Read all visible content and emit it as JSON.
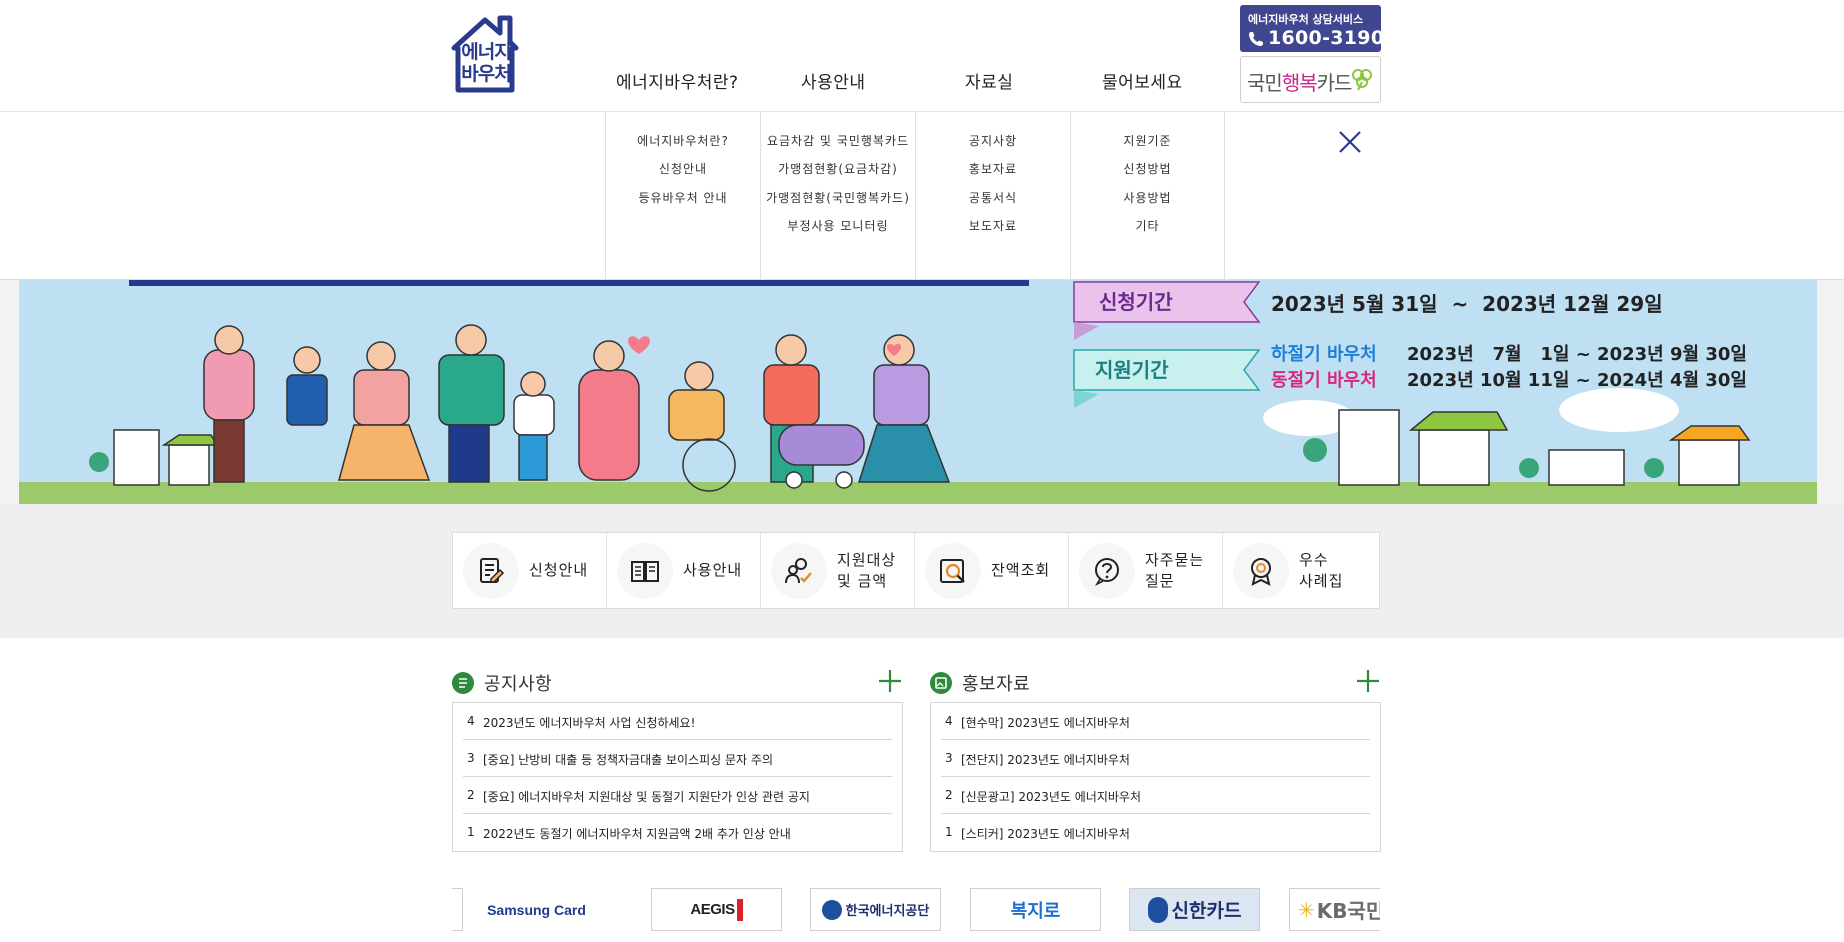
{
  "header": {
    "logo_text_line1": "에너지",
    "logo_text_line2": "바우처",
    "nav": [
      "에너지바우처란?",
      "사용안내",
      "자료실",
      "물어보세요"
    ],
    "hotline": {
      "label": "에너지바우처 상담서비스",
      "phone": "1600-3190"
    },
    "happycard": {
      "prefix": "국민",
      "accent": "행복",
      "suffix": "카드"
    }
  },
  "megamenu": {
    "columns": [
      [
        "에너지바우처란?",
        "신청안내",
        "등유바우처 안내"
      ],
      [
        "요금차감 및 국민행복카드",
        "가맹점현황(요금차감)",
        "가맹점현황(국민행복카드)",
        "부정사용 모니터링"
      ],
      [
        "공지사항",
        "홍보자료",
        "공통서식",
        "보도자료"
      ],
      [
        "지원기준",
        "신청방법",
        "사용방법",
        "기타"
      ]
    ]
  },
  "banner": {
    "apply_label": "신청기간",
    "apply_period": "2023년 5월 31일  ~  2023년 12월 29일",
    "support_label": "지원기간",
    "summer_label": "하절기 바우처",
    "summer_period": "2023년   7월   1일 ~ 2023년 9월 30일",
    "winter_label": "동절기 바우처",
    "winter_period": "2023년 10월 11일 ~ 2024년 4월 30일"
  },
  "quick_menu": [
    {
      "label": "신청안내",
      "icon": "document-pen-icon"
    },
    {
      "label": "사용안내",
      "icon": "open-book-icon"
    },
    {
      "label": "지원대상\n및 금액",
      "icon": "people-check-icon"
    },
    {
      "label": "잔액조회",
      "icon": "magnifier-icon"
    },
    {
      "label": "자주묻는\n질문",
      "icon": "question-icon"
    },
    {
      "label": "우수\n사례집",
      "icon": "award-icon"
    }
  ],
  "notice": {
    "title": "공지사항",
    "rows": [
      {
        "num": "4",
        "text": "2023년도 에너지바우처 사업 신청하세요!"
      },
      {
        "num": "3",
        "text": "[중요] 난방비 대출 등 정책자금대출 보이스피싱 문자 주의"
      },
      {
        "num": "2",
        "text": "[중요] 에너지바우처 지원대상 및 동절기 지원단가 인상 관련 공지"
      },
      {
        "num": "1",
        "text": "2022년도 동절기 에너지바우처 지원금액 2배 추가 인상 안내"
      }
    ]
  },
  "promo": {
    "title": "홍보자료",
    "rows": [
      {
        "num": "4",
        "text": "[현수막] 2023년도 에너지바우처"
      },
      {
        "num": "3",
        "text": "[전단지] 2023년도 에너지바우처"
      },
      {
        "num": "2",
        "text": "[신문광고] 2023년도 에너지바우처"
      },
      {
        "num": "1",
        "text": "[스티커] 2023년도 에너지바우처"
      }
    ]
  },
  "partners": [
    "Samsung Card",
    "AEGIS",
    "한국에너지공단",
    "복지로",
    "신한카드",
    "KB국민"
  ],
  "colors": {
    "brand_blue": "#2a3b8f",
    "hotline_bg": "#40468f",
    "green": "#2f8a3e",
    "banner_sky": "#bfe0f3"
  }
}
